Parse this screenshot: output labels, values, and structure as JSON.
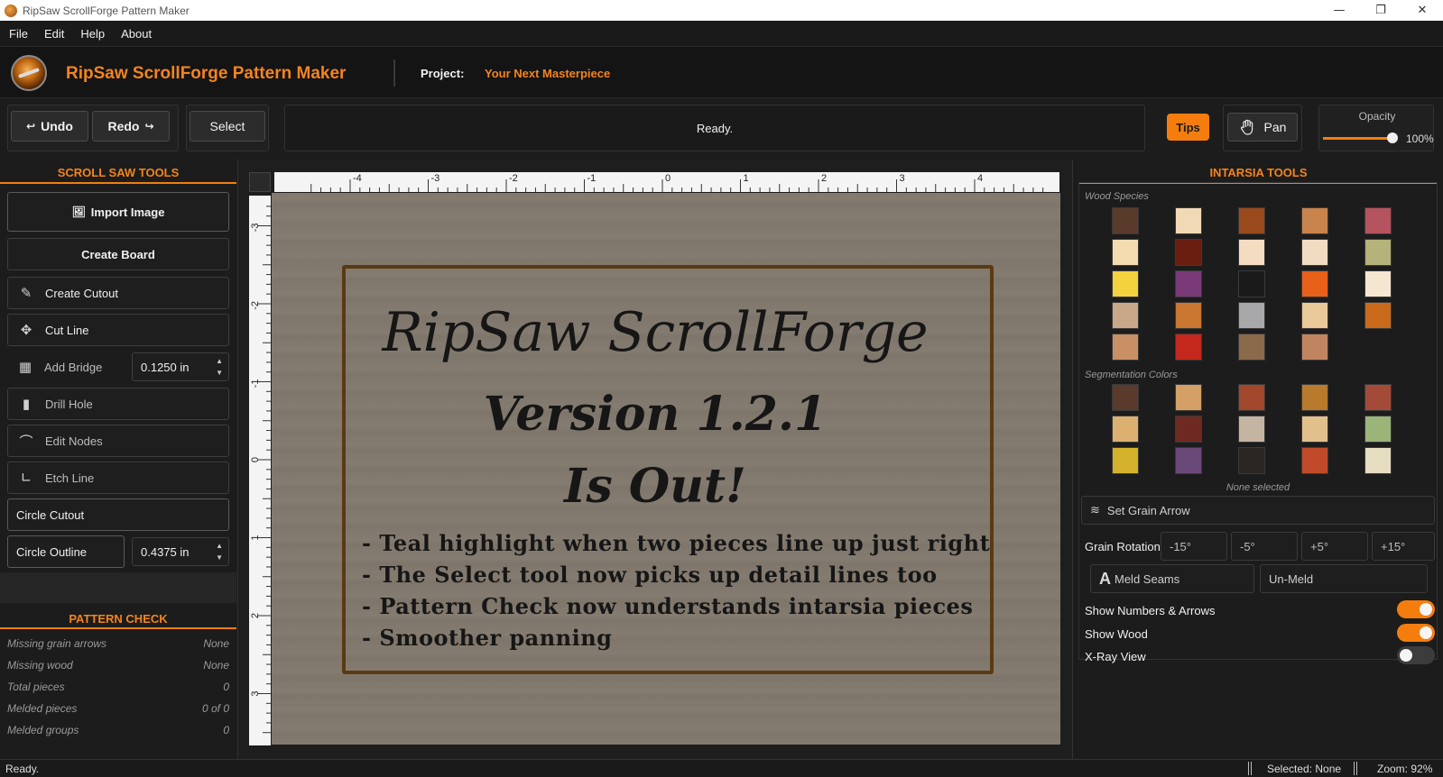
{
  "window": {
    "title": "RipSaw ScrollForge Pattern Maker"
  },
  "menu": [
    "File",
    "Edit",
    "Help",
    "About"
  ],
  "header": {
    "app_name": "RipSaw ScrollForge Pattern Maker",
    "project_label": "Project:",
    "project_name": "Your Next Masterpiece"
  },
  "toolbar": {
    "undo": "Undo",
    "redo": "Redo",
    "select": "Select",
    "status": "Ready.",
    "tips": "Tips",
    "pan": "Pan",
    "opacity_label": "Opacity",
    "opacity_value": "100%",
    "opacity_level": 1.0
  },
  "left": {
    "scroll_title": "SCROLL SAW TOOLS",
    "import_image": "Import Image",
    "create_board": "Create Board",
    "create_cutout": "Create Cutout",
    "cut_line": "Cut Line",
    "add_bridge": "Add Bridge",
    "bridge_value": "0.1250 in",
    "drill_hole": "Drill Hole",
    "edit_nodes": "Edit Nodes",
    "etch_line": "Etch Line",
    "circle_cutout": "Circle Cutout",
    "circle_outline": "Circle Outline",
    "circle_value": "0.4375 in",
    "pattern_title": "PATTERN CHECK",
    "checks": [
      {
        "label": "Missing grain arrows",
        "value": "None"
      },
      {
        "label": "Missing wood",
        "value": "None"
      },
      {
        "label": "Total pieces",
        "value": "0"
      },
      {
        "label": "Melded pieces",
        "value": "0 of 0"
      },
      {
        "label": "Melded groups",
        "value": "0"
      }
    ]
  },
  "canvas": {
    "ruler_h": [
      "-4",
      "-3",
      "-2",
      "-1",
      "0",
      "1",
      "2",
      "3",
      "4"
    ],
    "ruler_v": [
      "-3",
      "-2",
      "-1",
      "0",
      "1",
      "2",
      "3"
    ],
    "title": "RipSaw ScrollForge",
    "version": "Version 1.2.1",
    "is_out": "Is Out!",
    "notes": [
      "- Teal highlight when two pieces line up just right",
      "- The Select tool now picks up detail lines too",
      "- Pattern Check now understands intarsia pieces",
      "- Smoother panning"
    ]
  },
  "right": {
    "title": "INTARSIA TOOLS",
    "wood_label": "Wood Species",
    "wood_colors": [
      "#5a3a2a",
      "#f1d9b5",
      "#9a4a1c",
      "#c9834c",
      "#b5535e",
      "#f4dbb0",
      "#6a1e10",
      "#f3dcc0",
      "#f1dcc2",
      "#b5b27a",
      "#f3d23e",
      "#7a3a7a",
      "#1a1a1a",
      "#e8601a",
      "#f5e6d2",
      "#c9a88a",
      "#c87630",
      "#a8a8aa",
      "#e9c99a",
      "#c96a1a",
      "#c99066",
      "#c4271c",
      "#8a6a4a",
      "#c08560"
    ],
    "seg_label": "Segmentation Colors",
    "seg_colors": [
      "#5a3a2c",
      "#d4a066",
      "#a0472c",
      "#b87a2c",
      "#a44a38",
      "#dcb070",
      "#6e2a22",
      "#c4b4a2",
      "#e2c08c",
      "#9ab47a",
      "#d4b22c",
      "#6a4878",
      "#2a2624",
      "#c04a2a",
      "#e6dcc0"
    ],
    "none_selected": "None selected",
    "set_grain": "Set Grain Arrow",
    "grain_rotation": "Grain Rotation",
    "rotations": [
      "-15°",
      "-5°",
      "+5°",
      "+15°"
    ],
    "meld": "Meld Seams",
    "unmeld": "Un-Meld",
    "show_numbers": "Show Numbers & Arrows",
    "show_wood": "Show Wood",
    "xray": "X-Ray View"
  },
  "statusbar": {
    "left": "Ready.",
    "selected": "Selected: None",
    "zoom": "Zoom: 92%"
  }
}
